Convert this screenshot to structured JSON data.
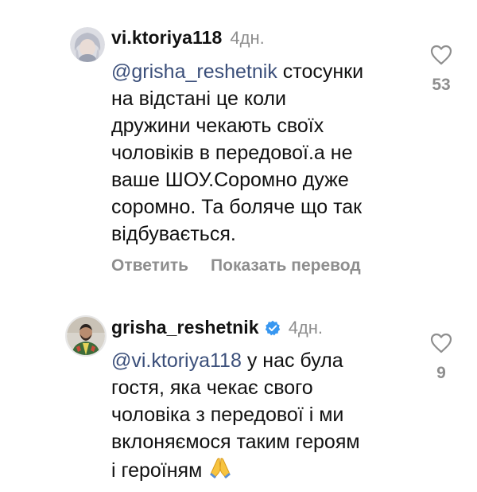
{
  "comments": [
    {
      "username": "vi.ktoriya118",
      "time": "4дн.",
      "mention": "@grisha_reshetnik",
      "text_lines": [
        " стосунки",
        "на відстані це коли",
        "дружини чекають своїх",
        "чоловіків в передової.а не",
        "ваше ШОУ.Соромно дуже",
        "соромно. Та боляче що так",
        "відбувається."
      ],
      "likes": "53",
      "reply_label": "Ответить",
      "translate_label": "Показать перевод"
    },
    {
      "username": "grisha_reshetnik",
      "time": "4дн.",
      "verified": true,
      "mention": "@vi.ktoriya118",
      "text_lines": [
        " у нас була",
        "гостя, яка чекає свого",
        "чоловіка з передової і ми",
        "вклоняємося таким героям",
        "і героїням"
      ],
      "emoji": "folded-hands",
      "likes": "9"
    }
  ],
  "icons": {
    "heart": "heart-outline-icon",
    "verified": "verified-badge-icon"
  },
  "colors": {
    "mention": "#3b4f7a",
    "muted": "#8e8e8e",
    "verified": "#3897f0"
  }
}
